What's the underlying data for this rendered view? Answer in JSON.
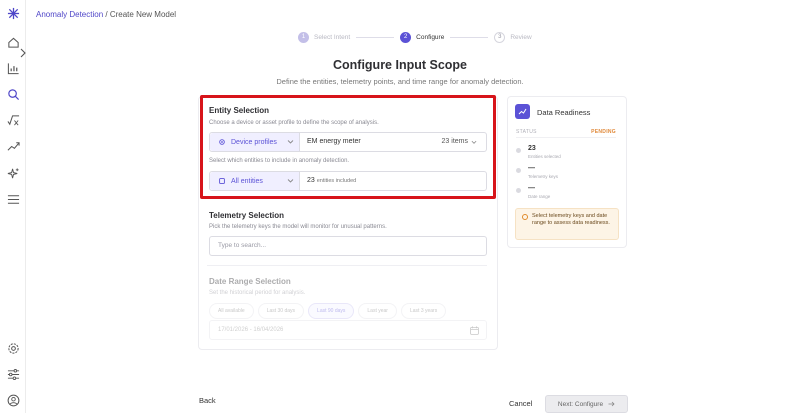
{
  "breadcrumb": {
    "parent": "Anomaly Detection",
    "separator": " / ",
    "current": "Create New Model"
  },
  "stepper": {
    "steps": [
      {
        "num": "1",
        "label": "Select Intent",
        "state": "done"
      },
      {
        "num": "2",
        "label": "Configure",
        "state": "active"
      },
      {
        "num": "3",
        "label": "Review",
        "state": "todo"
      }
    ]
  },
  "page": {
    "title": "Configure Input Scope",
    "subtitle": "Define the entities, telemetry points, and time range for anomaly detection."
  },
  "entity_selection": {
    "title": "Entity Selection",
    "description": "Choose a device or asset profile to define the scope of analysis.",
    "profile_type": "Device profiles",
    "profile_value": "EM energy meter",
    "profile_count": "23 items",
    "entities_description": "Select which entities to include in anomaly detection.",
    "entities_mode": "All entities",
    "entities_count": "23",
    "entities_count_suffix": "entities included"
  },
  "telemetry_selection": {
    "title": "Telemetry Selection",
    "description": "Pick the telemetry keys the model will monitor for unusual patterns.",
    "search_placeholder": "Type to search..."
  },
  "date_range": {
    "title": "Date Range Selection",
    "description": "Set the historical period for analysis.",
    "chips": [
      {
        "label": "All available",
        "selected": false
      },
      {
        "label": "Last 30 days",
        "selected": false
      },
      {
        "label": "Last 90 days",
        "selected": true
      },
      {
        "label": "Last year",
        "selected": false
      },
      {
        "label": "Last 3 years",
        "selected": false
      }
    ],
    "range_text": "17/01/2026 - 16/04/2026"
  },
  "readiness": {
    "title": "Data Readiness",
    "status_label": "STATUS",
    "status_value": "PENDING",
    "metrics": [
      {
        "value": "23",
        "label": "Entities selected"
      },
      {
        "value": "—",
        "label": "Telemetry keys"
      },
      {
        "value": "—",
        "label": "Date range"
      }
    ],
    "notice": "Select telemetry keys and date range to assess data readiness."
  },
  "footer": {
    "back": "Back",
    "cancel": "Cancel",
    "next": "Next: Configure"
  },
  "colors": {
    "accent": "#5b52d6",
    "highlight_border": "#d7141a",
    "pending": "#e0893a"
  },
  "icons": {
    "rail": [
      "logo-icon",
      "home-icon",
      "chart-icon",
      "anomaly-search-icon",
      "formula-icon",
      "trend-icon",
      "sparkle-icon",
      "menu-icon",
      "settings-icon",
      "sliders-icon",
      "user-icon"
    ]
  }
}
